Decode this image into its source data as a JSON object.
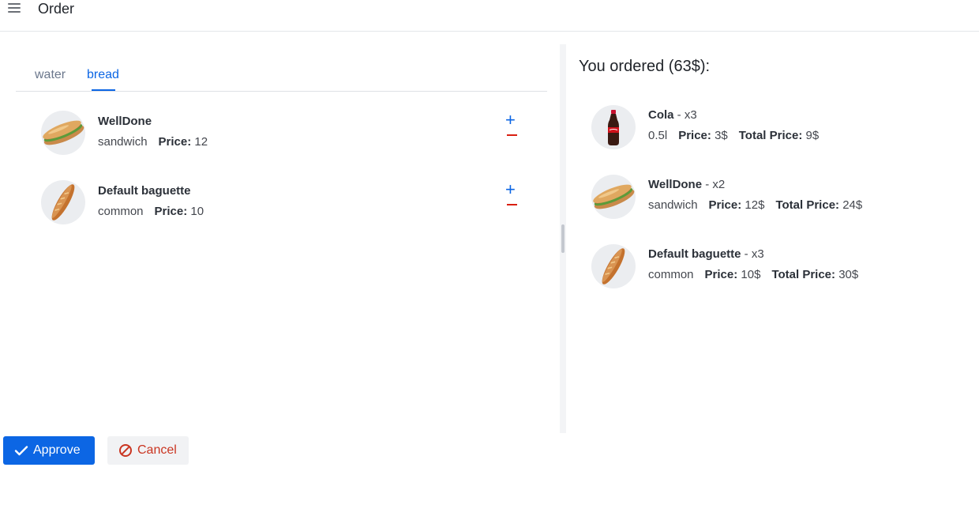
{
  "header": {
    "title": "Order",
    "menu_icon": "hamburger-menu-icon"
  },
  "tabs": [
    {
      "label": "water",
      "active": false
    },
    {
      "label": "bread",
      "active": true
    }
  ],
  "products": [
    {
      "name": "WellDone",
      "variant": "sandwich",
      "price_label": "Price:",
      "price": "12",
      "image": "sandwich-image"
    },
    {
      "name": "Default baguette",
      "variant": "common",
      "price_label": "Price:",
      "price": "10",
      "image": "baguette-image"
    }
  ],
  "summary": {
    "title": "You ordered (63$):",
    "items": [
      {
        "name": "Cola",
        "qty": " - x3",
        "variant": "0.5l",
        "price_label": "Price:",
        "price": "3$",
        "total_label": "Total Price:",
        "total": "9$",
        "image": "cola-bottle-image"
      },
      {
        "name": "WellDone",
        "qty": " - x2",
        "variant": "sandwich",
        "price_label": "Price:",
        "price": "12$",
        "total_label": "Total Price:",
        "total": "24$",
        "image": "sandwich-image"
      },
      {
        "name": "Default baguette",
        "qty": " - x3",
        "variant": "common",
        "price_label": "Price:",
        "price": "10$",
        "total_label": "Total Price:",
        "total": "30$",
        "image": "baguette-image"
      }
    ]
  },
  "actions": {
    "approve_label": "Approve",
    "cancel_label": "Cancel"
  },
  "colors": {
    "accent": "#0c66e4",
    "danger": "#d91f11",
    "cancel_text": "#ca3521"
  }
}
